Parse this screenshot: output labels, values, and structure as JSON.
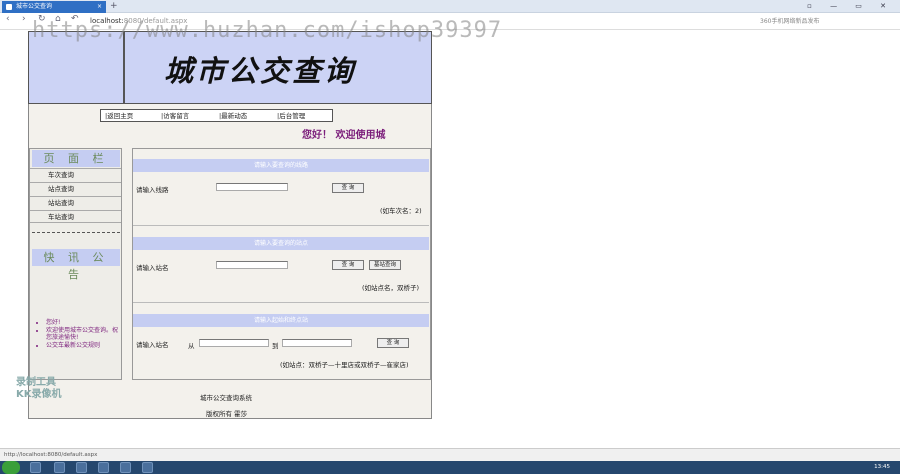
{
  "browser": {
    "tab_title": "城市公交查询",
    "tab_close": "×",
    "new_tab": "+",
    "address": "localhost:8080/default.aspx",
    "address_host": "localhost:",
    "address_rest": "8080/default.aspx",
    "search_hint": "360手机网络新品发布",
    "window_controls": "▫ — ▭ ✕"
  },
  "watermark": "https://www.huzhan.com/ishop39397",
  "header": {
    "title": "城市公交查询"
  },
  "menu": [
    {
      "label": "|返回主页"
    },
    {
      "label": "|访客留言"
    },
    {
      "label": "|最新动态"
    },
    {
      "label": "|后台管理"
    }
  ],
  "welcome": "您好！ 欢迎使用城",
  "sidebar": {
    "head": "页 面 栏",
    "items": [
      "车次查询",
      "站点查询",
      "站站查询",
      "车站查询"
    ],
    "notice_head": "快 讯 公 告",
    "notices": [
      "您好!",
      "欢迎使用城市公交查询。祝您旅途愉快!",
      "公交车最新公交规则"
    ]
  },
  "sections": [
    {
      "head": "请输入要查询的线路",
      "label": "请输入线路",
      "button": "查 询",
      "hint": "(如车次名：2)"
    },
    {
      "head": "请输入要查询的站点",
      "label": "请输入站名",
      "button": "查 询",
      "button2": "基站查询",
      "hint": "(如站点名，双桥子)"
    },
    {
      "head": "请输入起始和终点站",
      "label": "请输入站名",
      "from": "从",
      "to": "到",
      "button": "查 询",
      "hint": "(如站点：双桥子—十里店或双桥子—崔家店)"
    }
  ],
  "footer": {
    "line1": "城市公交查询系统",
    "line2": "版权所有 霍莎"
  },
  "overlay": {
    "kk1": "录制工具",
    "kk2": "KK录像机"
  },
  "status": {
    "url": "http://localhost:8080/default.aspx",
    "clock": "13:45"
  },
  "colors": {
    "banner": "#ccd3f5",
    "welcome": "#7b1e7b",
    "tab": "#2f6fc4",
    "taskbar": "#25476e"
  }
}
